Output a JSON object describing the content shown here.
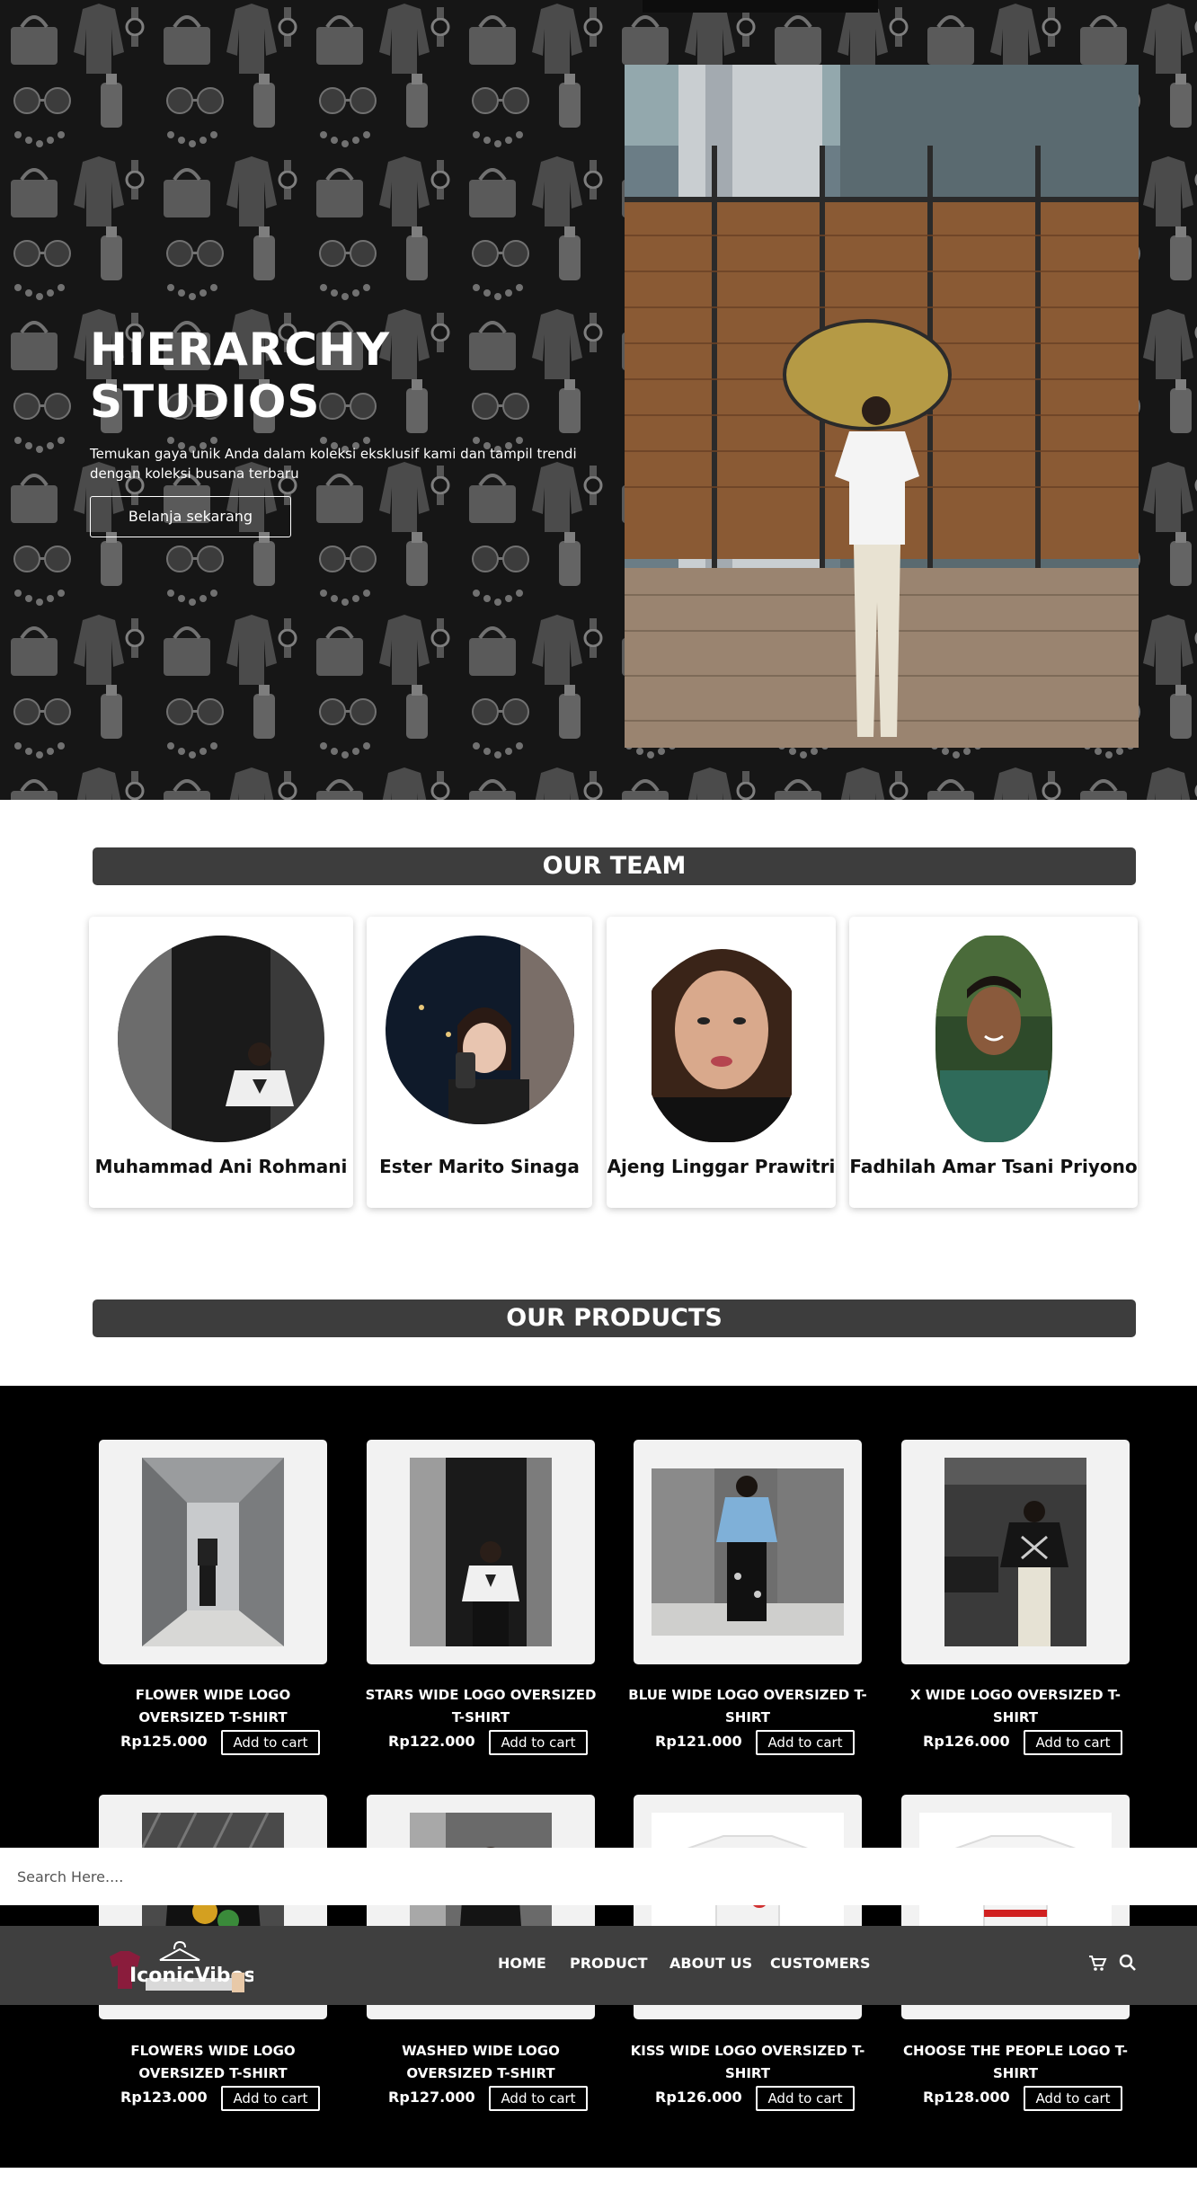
{
  "hero": {
    "title": "HIERARCHY STUDIOS",
    "subtitle": "Temukan gaya unik Anda dalam koleksi eksklusif kami dan tampil trendi dengan koleksi busana terbaru",
    "cta_label": "Belanja sekarang"
  },
  "team": {
    "title": "OUR TEAM",
    "members": [
      {
        "name": "Muhammad Ani Rohmani"
      },
      {
        "name": "Ester Marito Sinaga"
      },
      {
        "name": "Ajeng Linggar Prawitri"
      },
      {
        "name": "Fadhilah Amar Tsani Priyono"
      }
    ]
  },
  "products": {
    "title": "OUR PRODUCTS",
    "cart_label": "Add to cart",
    "items": [
      {
        "name": "FLOWER WIDE LOGO OVERSIZED T-SHIRT",
        "price": "Rp125.000"
      },
      {
        "name": "STARS WIDE LOGO OVERSIZED T-SHIRT",
        "price": "Rp122.000"
      },
      {
        "name": "BLUE WIDE LOGO OVERSIZED T-SHIRT",
        "price": "Rp121.000"
      },
      {
        "name": "X WIDE LOGO OVERSIZED T-SHIRT",
        "price": "Rp126.000"
      },
      {
        "name": "FLOWERS WIDE LOGO OVERSIZED T-SHIRT",
        "price": "Rp123.000"
      },
      {
        "name": "WASHED WIDE LOGO OVERSIZED T-SHIRT",
        "price": "Rp127.000"
      },
      {
        "name": "KISS WIDE LOGO OVERSIZED T-SHIRT",
        "price": "Rp126.000"
      },
      {
        "name": "CHOOSE THE PEOPLE LOGO T-SHIRT",
        "price": "Rp128.000"
      }
    ]
  },
  "search": {
    "placeholder": "Search Here...."
  },
  "nav": {
    "logo_text": "IconicVibes",
    "links": [
      "HOME",
      "PRODUCT",
      "ABOUT US",
      "CUSTOMERS"
    ],
    "icons": [
      "cart-icon",
      "search-icon"
    ]
  },
  "colors": {
    "nav_bg": "#3f3f3f",
    "section_title_bg": "#3d3d3d",
    "product_band_bg": "#000000",
    "hero_bg": "#1b1b1b"
  }
}
